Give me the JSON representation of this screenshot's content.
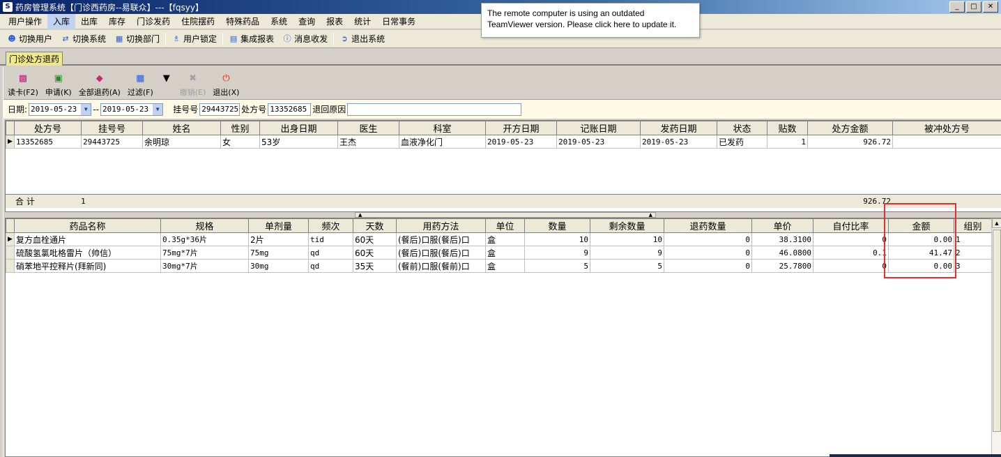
{
  "window": {
    "title": "药房管理系统【门诊西药房--易联众】---【fqsyy】",
    "buttons": [
      "_",
      "□",
      "✕"
    ]
  },
  "menubar": [
    "用户操作",
    "入库",
    "出库",
    "库存",
    "门诊发药",
    "住院摆药",
    "特殊药品",
    "系统",
    "查询",
    "报表",
    "统计",
    "日常事务"
  ],
  "toolbar": [
    {
      "label": "切换用户",
      "icon": "switch-user-icon"
    },
    {
      "label": "切换系统",
      "icon": "switch-system-icon"
    },
    {
      "label": "切换部门",
      "icon": "switch-dept-icon"
    },
    {
      "label": "用户锁定",
      "icon": "lock-user-icon"
    },
    {
      "label": "集成报表",
      "icon": "report-icon"
    },
    {
      "label": "消息收发",
      "icon": "message-icon"
    },
    {
      "label": "退出系统",
      "icon": "exit-system-icon"
    }
  ],
  "teamviewer_popup": {
    "line1": "The remote computer is using an outdated",
    "line2": "TeamViewer version. Please click here to update it."
  },
  "tab": "门诊处方退药",
  "actions": [
    {
      "label": "读卡(F2)",
      "icon": "card-reader-icon",
      "enabled": true
    },
    {
      "label": "申请(K)",
      "icon": "apply-icon",
      "enabled": true
    },
    {
      "label": "全部退药(A)",
      "icon": "eraser-icon",
      "enabled": true
    },
    {
      "label": "过滤(F)",
      "icon": "filter-icon",
      "enabled": true
    },
    {
      "label": "撤销(E)",
      "icon": "cancel-x-icon",
      "enabled": false
    },
    {
      "label": "退出(X)",
      "icon": "power-icon",
      "enabled": true
    }
  ],
  "filter": {
    "date_label": "日期:",
    "date_from": "2019-05-23",
    "date_sep": "--",
    "date_to": "2019-05-23",
    "reg_label": "挂号号",
    "reg_value": "29443725",
    "presc_label": "处方号",
    "presc_value": "13352685",
    "reason_label": "退回原因",
    "reason_value": ""
  },
  "prescriptions": {
    "columns": [
      "处方号",
      "挂号号",
      "姓名",
      "性别",
      "出身日期",
      "医生",
      "科室",
      "开方日期",
      "记账日期",
      "发药日期",
      "状态",
      "贴数",
      "处方金额",
      "被冲处方号"
    ],
    "rows": [
      [
        "13352685",
        "29443725",
        "余明琼",
        "女",
        "53岁",
        "王杰",
        "血液净化门",
        "2019-05-23",
        "2019-05-23",
        "2019-05-23",
        "已发药",
        "1",
        "926.72",
        ""
      ]
    ],
    "summary": {
      "label": "合 计",
      "count": "1",
      "amount": "926.72"
    }
  },
  "drugs": {
    "columns": [
      "药品名称",
      "规格",
      "单剂量",
      "频次",
      "天数",
      "用药方法",
      "单位",
      "数量",
      "剩余数量",
      "退药数量",
      "单价",
      "自付比率",
      "金额",
      "组别"
    ],
    "rows": [
      [
        "复方血栓通片",
        "0.35g*36片",
        "2片",
        "tid",
        "60天",
        "(餐后)口服(餐后)口",
        "盒",
        "10",
        "10",
        "0",
        "38.3100",
        "0",
        "0.00",
        "1"
      ],
      [
        "硫酸氢氯吡格雷片（帅信）",
        "75mg*7片",
        "75mg",
        "qd",
        "60天",
        "(餐后)口服(餐后)口",
        "盒",
        "9",
        "9",
        "0",
        "46.0800",
        "0.1",
        "41.47",
        "2"
      ],
      [
        "硝苯地平控释片(拜新同)",
        "30mg*7片",
        "30mg",
        "qd",
        "35天",
        "(餐前)口服(餐前)口",
        "盒",
        "5",
        "5",
        "0",
        "25.7800",
        "0",
        "0.00",
        "3"
      ]
    ]
  },
  "colors": {
    "highlight_box": "#e03030",
    "tab_bg": "#f0e68c",
    "filter_bg": "#fff9e6"
  }
}
